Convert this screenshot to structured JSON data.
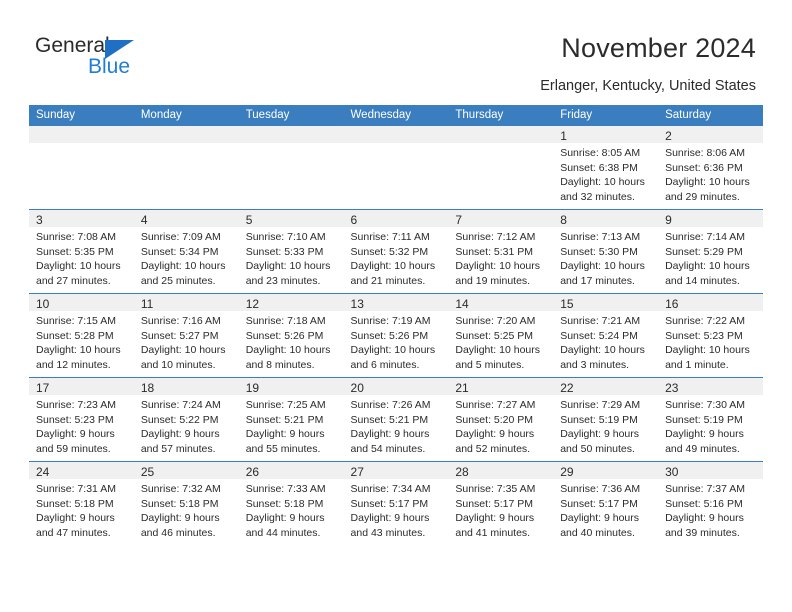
{
  "brand": {
    "name_top": "General",
    "name_bottom": "Blue",
    "triangle_color": "#1f6fc4",
    "blue_text_color": "#1f7fd4"
  },
  "header": {
    "title": "November 2024",
    "location": "Erlanger, Kentucky, United States"
  },
  "theme": {
    "header_row_bg": "#3a7ebf",
    "header_row_text": "#ffffff",
    "daynum_band_bg": "#f0f0f0",
    "row_divider": "#3a7ebf",
    "text": "#2b2b2b"
  },
  "weekday_headers": [
    "Sunday",
    "Monday",
    "Tuesday",
    "Wednesday",
    "Thursday",
    "Friday",
    "Saturday"
  ],
  "labels": {
    "sunrise_prefix": "Sunrise:",
    "sunset_prefix": "Sunset:",
    "daylight_prefix": "Daylight:"
  },
  "weeks": [
    [
      {
        "empty": true
      },
      {
        "empty": true
      },
      {
        "empty": true
      },
      {
        "empty": true
      },
      {
        "empty": true
      },
      {
        "day": "1",
        "sunrise": "Sunrise: 8:05 AM",
        "sunset": "Sunset: 6:38 PM",
        "daylight_l1": "Daylight: 10 hours",
        "daylight_l2": "and 32 minutes."
      },
      {
        "day": "2",
        "sunrise": "Sunrise: 8:06 AM",
        "sunset": "Sunset: 6:36 PM",
        "daylight_l1": "Daylight: 10 hours",
        "daylight_l2": "and 29 minutes."
      }
    ],
    [
      {
        "day": "3",
        "sunrise": "Sunrise: 7:08 AM",
        "sunset": "Sunset: 5:35 PM",
        "daylight_l1": "Daylight: 10 hours",
        "daylight_l2": "and 27 minutes."
      },
      {
        "day": "4",
        "sunrise": "Sunrise: 7:09 AM",
        "sunset": "Sunset: 5:34 PM",
        "daylight_l1": "Daylight: 10 hours",
        "daylight_l2": "and 25 minutes."
      },
      {
        "day": "5",
        "sunrise": "Sunrise: 7:10 AM",
        "sunset": "Sunset: 5:33 PM",
        "daylight_l1": "Daylight: 10 hours",
        "daylight_l2": "and 23 minutes."
      },
      {
        "day": "6",
        "sunrise": "Sunrise: 7:11 AM",
        "sunset": "Sunset: 5:32 PM",
        "daylight_l1": "Daylight: 10 hours",
        "daylight_l2": "and 21 minutes."
      },
      {
        "day": "7",
        "sunrise": "Sunrise: 7:12 AM",
        "sunset": "Sunset: 5:31 PM",
        "daylight_l1": "Daylight: 10 hours",
        "daylight_l2": "and 19 minutes."
      },
      {
        "day": "8",
        "sunrise": "Sunrise: 7:13 AM",
        "sunset": "Sunset: 5:30 PM",
        "daylight_l1": "Daylight: 10 hours",
        "daylight_l2": "and 17 minutes."
      },
      {
        "day": "9",
        "sunrise": "Sunrise: 7:14 AM",
        "sunset": "Sunset: 5:29 PM",
        "daylight_l1": "Daylight: 10 hours",
        "daylight_l2": "and 14 minutes."
      }
    ],
    [
      {
        "day": "10",
        "sunrise": "Sunrise: 7:15 AM",
        "sunset": "Sunset: 5:28 PM",
        "daylight_l1": "Daylight: 10 hours",
        "daylight_l2": "and 12 minutes."
      },
      {
        "day": "11",
        "sunrise": "Sunrise: 7:16 AM",
        "sunset": "Sunset: 5:27 PM",
        "daylight_l1": "Daylight: 10 hours",
        "daylight_l2": "and 10 minutes."
      },
      {
        "day": "12",
        "sunrise": "Sunrise: 7:18 AM",
        "sunset": "Sunset: 5:26 PM",
        "daylight_l1": "Daylight: 10 hours",
        "daylight_l2": "and 8 minutes."
      },
      {
        "day": "13",
        "sunrise": "Sunrise: 7:19 AM",
        "sunset": "Sunset: 5:26 PM",
        "daylight_l1": "Daylight: 10 hours",
        "daylight_l2": "and 6 minutes."
      },
      {
        "day": "14",
        "sunrise": "Sunrise: 7:20 AM",
        "sunset": "Sunset: 5:25 PM",
        "daylight_l1": "Daylight: 10 hours",
        "daylight_l2": "and 5 minutes."
      },
      {
        "day": "15",
        "sunrise": "Sunrise: 7:21 AM",
        "sunset": "Sunset: 5:24 PM",
        "daylight_l1": "Daylight: 10 hours",
        "daylight_l2": "and 3 minutes."
      },
      {
        "day": "16",
        "sunrise": "Sunrise: 7:22 AM",
        "sunset": "Sunset: 5:23 PM",
        "daylight_l1": "Daylight: 10 hours",
        "daylight_l2": "and 1 minute."
      }
    ],
    [
      {
        "day": "17",
        "sunrise": "Sunrise: 7:23 AM",
        "sunset": "Sunset: 5:23 PM",
        "daylight_l1": "Daylight: 9 hours",
        "daylight_l2": "and 59 minutes."
      },
      {
        "day": "18",
        "sunrise": "Sunrise: 7:24 AM",
        "sunset": "Sunset: 5:22 PM",
        "daylight_l1": "Daylight: 9 hours",
        "daylight_l2": "and 57 minutes."
      },
      {
        "day": "19",
        "sunrise": "Sunrise: 7:25 AM",
        "sunset": "Sunset: 5:21 PM",
        "daylight_l1": "Daylight: 9 hours",
        "daylight_l2": "and 55 minutes."
      },
      {
        "day": "20",
        "sunrise": "Sunrise: 7:26 AM",
        "sunset": "Sunset: 5:21 PM",
        "daylight_l1": "Daylight: 9 hours",
        "daylight_l2": "and 54 minutes."
      },
      {
        "day": "21",
        "sunrise": "Sunrise: 7:27 AM",
        "sunset": "Sunset: 5:20 PM",
        "daylight_l1": "Daylight: 9 hours",
        "daylight_l2": "and 52 minutes."
      },
      {
        "day": "22",
        "sunrise": "Sunrise: 7:29 AM",
        "sunset": "Sunset: 5:19 PM",
        "daylight_l1": "Daylight: 9 hours",
        "daylight_l2": "and 50 minutes."
      },
      {
        "day": "23",
        "sunrise": "Sunrise: 7:30 AM",
        "sunset": "Sunset: 5:19 PM",
        "daylight_l1": "Daylight: 9 hours",
        "daylight_l2": "and 49 minutes."
      }
    ],
    [
      {
        "day": "24",
        "sunrise": "Sunrise: 7:31 AM",
        "sunset": "Sunset: 5:18 PM",
        "daylight_l1": "Daylight: 9 hours",
        "daylight_l2": "and 47 minutes."
      },
      {
        "day": "25",
        "sunrise": "Sunrise: 7:32 AM",
        "sunset": "Sunset: 5:18 PM",
        "daylight_l1": "Daylight: 9 hours",
        "daylight_l2": "and 46 minutes."
      },
      {
        "day": "26",
        "sunrise": "Sunrise: 7:33 AM",
        "sunset": "Sunset: 5:18 PM",
        "daylight_l1": "Daylight: 9 hours",
        "daylight_l2": "and 44 minutes."
      },
      {
        "day": "27",
        "sunrise": "Sunrise: 7:34 AM",
        "sunset": "Sunset: 5:17 PM",
        "daylight_l1": "Daylight: 9 hours",
        "daylight_l2": "and 43 minutes."
      },
      {
        "day": "28",
        "sunrise": "Sunrise: 7:35 AM",
        "sunset": "Sunset: 5:17 PM",
        "daylight_l1": "Daylight: 9 hours",
        "daylight_l2": "and 41 minutes."
      },
      {
        "day": "29",
        "sunrise": "Sunrise: 7:36 AM",
        "sunset": "Sunset: 5:17 PM",
        "daylight_l1": "Daylight: 9 hours",
        "daylight_l2": "and 40 minutes."
      },
      {
        "day": "30",
        "sunrise": "Sunrise: 7:37 AM",
        "sunset": "Sunset: 5:16 PM",
        "daylight_l1": "Daylight: 9 hours",
        "daylight_l2": "and 39 minutes."
      }
    ]
  ]
}
